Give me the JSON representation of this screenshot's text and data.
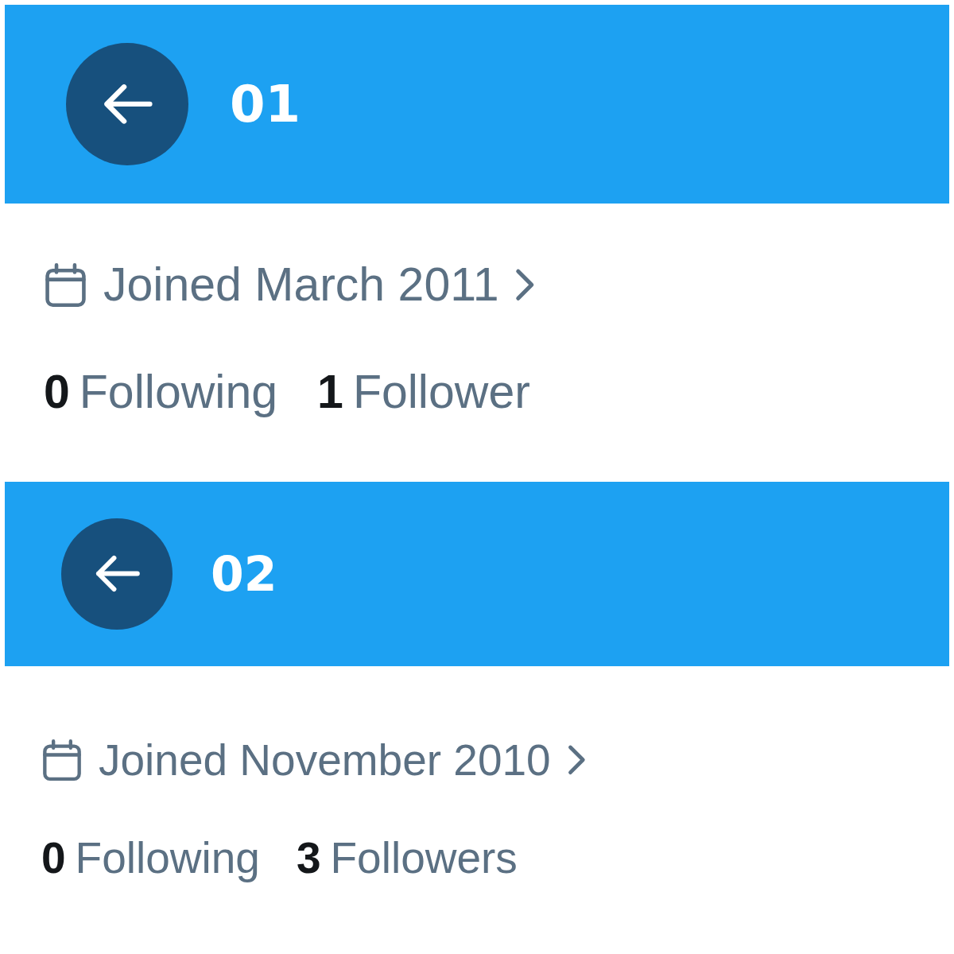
{
  "profiles": [
    {
      "header": {
        "title": "01"
      },
      "joined": "Joined March 2011",
      "stats": [
        {
          "count": "0",
          "label": "Following"
        },
        {
          "count": "1",
          "label": "Follower"
        }
      ]
    },
    {
      "header": {
        "title": "02"
      },
      "joined": "Joined November 2010",
      "stats": [
        {
          "count": "0",
          "label": "Following"
        },
        {
          "count": "3",
          "label": "Followers"
        }
      ]
    }
  ]
}
